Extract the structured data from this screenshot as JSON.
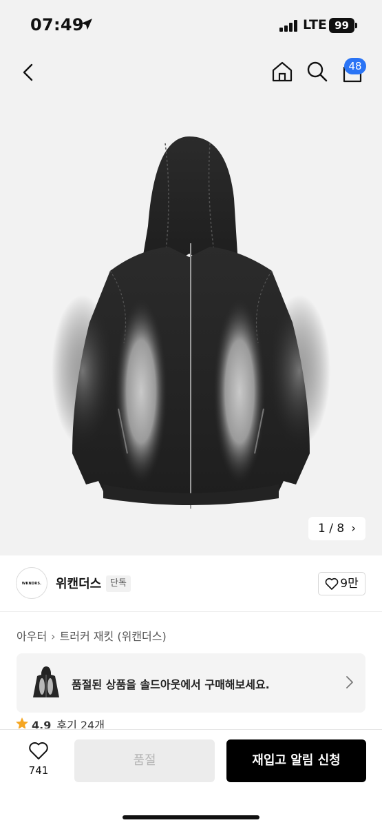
{
  "status_bar": {
    "time": "07:49",
    "network": "LTE",
    "battery": "99"
  },
  "nav": {
    "cart_badge": "48",
    "icons": [
      "back-icon",
      "home-icon",
      "search-icon",
      "cart-icon"
    ]
  },
  "gallery": {
    "pager_text": "1 / 8",
    "current": 1,
    "total": 8,
    "background": "#f2f2f2"
  },
  "brand": {
    "logo_text": "WKNDRS.",
    "name": "위캔더스",
    "tag": "단독",
    "likes": "9만"
  },
  "breadcrumb": {
    "category": "아우터",
    "product": "트러커 재킷 (위캔더스)"
  },
  "banner": {
    "text": "품절된 상품을 솔드아웃에서 구매해보세요."
  },
  "rating": {
    "score": "4.9",
    "reviews": "후기 24개"
  },
  "bottom_bar": {
    "wish_count": "741",
    "soldout_label": "품절",
    "restock_label": "재입고 알림 신청"
  },
  "colors": {
    "accent": "#2a74f5",
    "primary_button": "#000000",
    "disabled_button": "#ececec",
    "star": "#f5a623"
  }
}
